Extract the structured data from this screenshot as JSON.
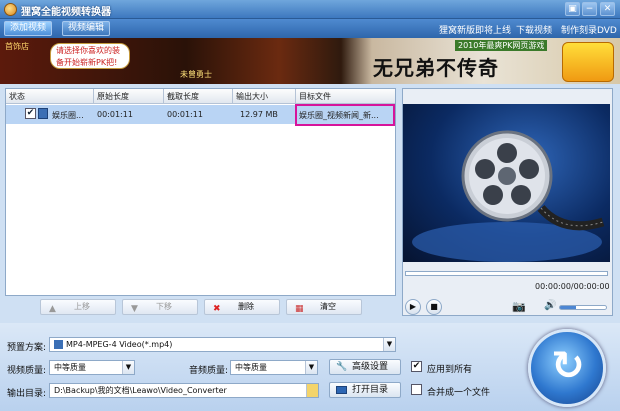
{
  "window": {
    "title": "狸窝全能视频转换器",
    "controls": [
      "▣",
      "−",
      "✕"
    ]
  },
  "toolbar": {
    "add_video": "添加视频",
    "edit_video": "视频编辑",
    "links": [
      "狸窝新版即将上线",
      "下载视频",
      "制作刻录DVD"
    ]
  },
  "banner": {
    "store_label": "首饰店",
    "bubble_text": "请选择你喜欢的装备开始崭新PK把!",
    "hero_label": "未曾勇士",
    "game_subtitle": "2010年最爽PK网页游戏",
    "game_title": "无兄弟不传奇"
  },
  "list": {
    "columns": [
      "状态",
      "原始长度",
      "截取长度",
      "输出大小",
      "目标文件"
    ],
    "rows": [
      {
        "checked": "✔",
        "name": "娱乐圈...",
        "original_length": "00:01:11",
        "clip_length": "00:01:11",
        "output_size": "12.97 MB",
        "target_file": "娱乐圈_视频新闻_新..."
      }
    ]
  },
  "list_buttons": {
    "up": "上移",
    "down": "下移",
    "delete": "删除",
    "clear": "清空"
  },
  "player": {
    "timecode": "00:00:00/00:00:00",
    "volume_level": 0.35
  },
  "settings": {
    "preset_label": "预置方案:",
    "preset_value": "MP4-MPEG-4 Video(*.mp4)",
    "video_quality_label": "视频质量:",
    "video_quality_value": "中等质量",
    "audio_quality_label": "音频质量:",
    "audio_quality_value": "中等质量",
    "advanced_button": "高级设置",
    "apply_all_label": "应用到所有",
    "apply_all_checked": "✔",
    "output_dir_label": "输出目录:",
    "output_dir_value": "D:\\Backup\\我的文档\\Leawo\\Video_Converter",
    "open_dir_button": "打开目录",
    "merge_label": "合并成一个文件"
  },
  "colors": {
    "accent": "#3d78bf",
    "selection_row": "#b9d4f4",
    "highlight_border": "#d6149b"
  }
}
